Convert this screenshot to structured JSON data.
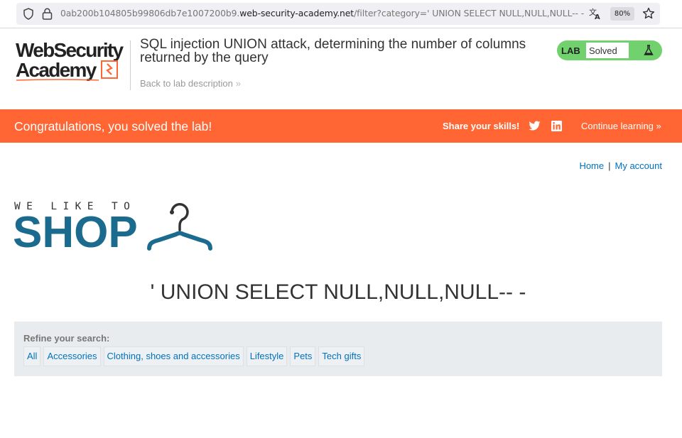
{
  "browser": {
    "url_prefix": "0ab200b104805b99806db7e1007200b9.",
    "url_domain": "web-security-academy.net",
    "url_path": "/filter?category=' UNION SELECT NULL,NULL,NULL-- -",
    "zoom": "80%"
  },
  "academy": {
    "logo_line1": "WebSecurity",
    "logo_line2": "Academy",
    "lab_title": "SQL injection UNION attack, determining the number of columns returned by the query",
    "back_link": "Back to lab description",
    "back_chevron": "»",
    "badge_label": "LAB",
    "badge_status": "Solved"
  },
  "banner": {
    "message": "Congratulations, you solved the lab!",
    "share_label": "Share your skills!",
    "continue_label": "Continue learning",
    "continue_chevron": "»"
  },
  "nav": {
    "home": "Home",
    "separator": "|",
    "account": "My account"
  },
  "shop_logo": {
    "tagline": "WE LIKE TO",
    "word": "SHOP"
  },
  "main": {
    "heading": "' UNION SELECT NULL,NULL,NULL-- -"
  },
  "filter": {
    "label": "Refine your search:",
    "categories": [
      "All",
      "Accessories",
      "Clothing, shoes and accessories",
      "Lifestyle",
      "Pets",
      "Tech gifts"
    ]
  },
  "colors": {
    "banner": "#ff6633",
    "link": "#0071bc",
    "shop_blue": "#1b6b8e",
    "lab_green": "#70d16d"
  },
  "icons": [
    "shield-icon",
    "lock-icon",
    "translate-icon",
    "star-icon",
    "flask-icon",
    "twitter-icon",
    "linkedin-icon",
    "hanger-icon"
  ]
}
